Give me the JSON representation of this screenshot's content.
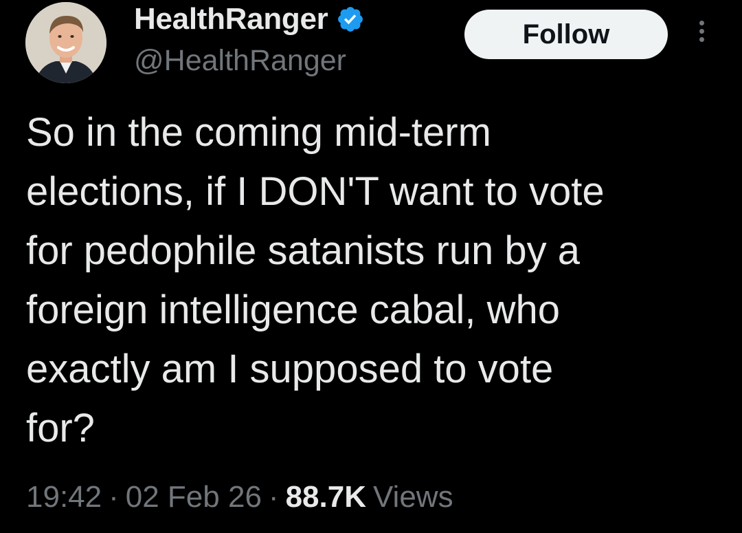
{
  "author": {
    "display_name": "HealthRanger",
    "handle": "@HealthRanger",
    "verified": true,
    "verified_color": "#1d9bf0"
  },
  "actions": {
    "follow_label": "Follow",
    "more_icon": "more-vertical-icon"
  },
  "tweet": {
    "text": "So in the coming mid-term\nelections, if I DON'T want to vote\nfor pedophile satanists run by a\nforeign intelligence cabal, who\nexactly am I supposed to vote\nfor?"
  },
  "meta": {
    "time": "19:42",
    "date": "02 Feb 26",
    "separator": "·",
    "views_count": "88.7K",
    "views_label": "Views"
  },
  "colors": {
    "background": "#000000",
    "primary_text": "#e7e9ea",
    "secondary_text": "#71767b",
    "follow_bg": "#eff3f4",
    "follow_text": "#0f1419"
  }
}
